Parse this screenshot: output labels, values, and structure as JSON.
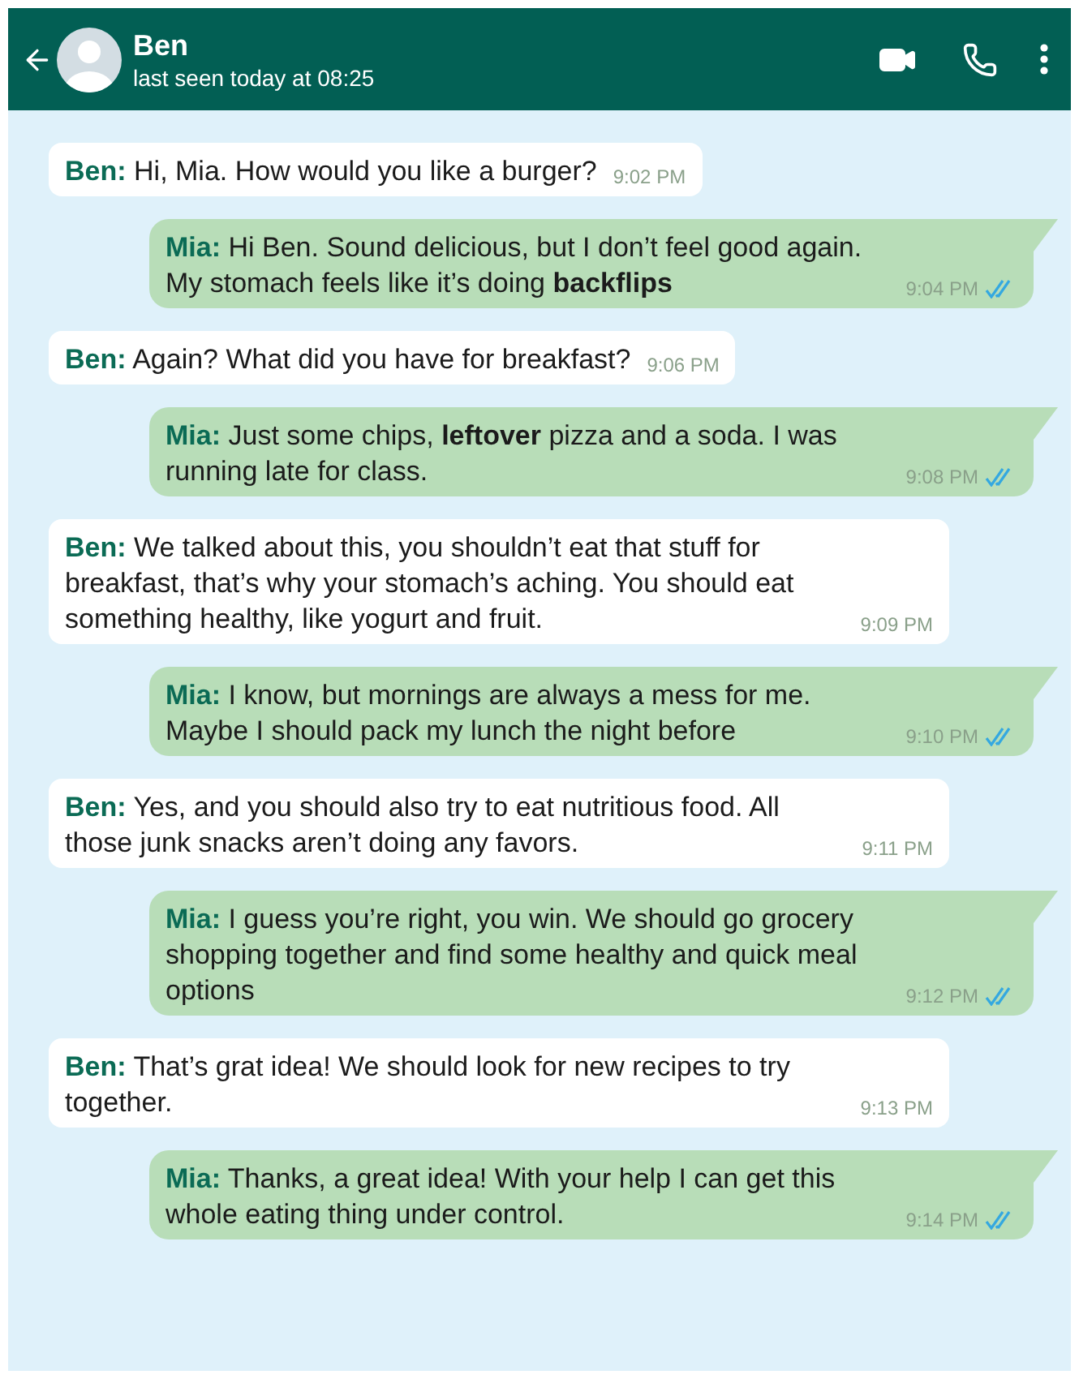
{
  "header": {
    "name": "Ben",
    "status": "last seen today at 08:25"
  },
  "messages": [
    {
      "kind": "incoming",
      "sender": "Ben:",
      "text": "Hi, Mia. How would you like a burger?",
      "time": "9:02 PM"
    },
    {
      "kind": "outgoing",
      "sender": "Mia:",
      "text": "Hi Ben. Sound delicious, but I don’t feel good again. My stomach feels like it’s doing **backflips**",
      "time": "9:04 PM",
      "read": true
    },
    {
      "kind": "incoming",
      "sender": "Ben:",
      "text": "Again? What did you have for breakfast?",
      "time": "9:06 PM"
    },
    {
      "kind": "outgoing",
      "sender": "Mia:",
      "text": "Just some chips, **leftover** pizza and a soda. I was running late for class.",
      "time": "9:08 PM",
      "read": true
    },
    {
      "kind": "incoming",
      "sender": "Ben:",
      "text": "We talked about this, you shouldn’t eat that stuff for breakfast, that’s why your stomach’s aching. You should eat something healthy, like yogurt and fruit.",
      "time": "9:09 PM"
    },
    {
      "kind": "outgoing",
      "sender": "Mia:",
      "text": "I know, but mornings are always a mess for me. Maybe I should pack my lunch the night before",
      "time": "9:10 PM",
      "read": true
    },
    {
      "kind": "incoming",
      "sender": "Ben:",
      "text": "Yes, and you should also try to eat nutritious food. All those junk snacks aren’t doing any favors.",
      "time": "9:11 PM"
    },
    {
      "kind": "outgoing",
      "sender": "Mia:",
      "text": "I guess you’re right, you win. We should go grocery shopping together and find some healthy and quick meal options",
      "time": "9:12 PM",
      "read": true
    },
    {
      "kind": "incoming",
      "sender": "Ben:",
      "text": "That’s grat idea! We should look for new recipes to try together.",
      "time": "9:13 PM"
    },
    {
      "kind": "outgoing",
      "sender": "Mia:",
      "text": "Thanks, a great idea! With your help I can get this whole eating thing under control.",
      "time": "9:14 PM",
      "read": true
    }
  ]
}
